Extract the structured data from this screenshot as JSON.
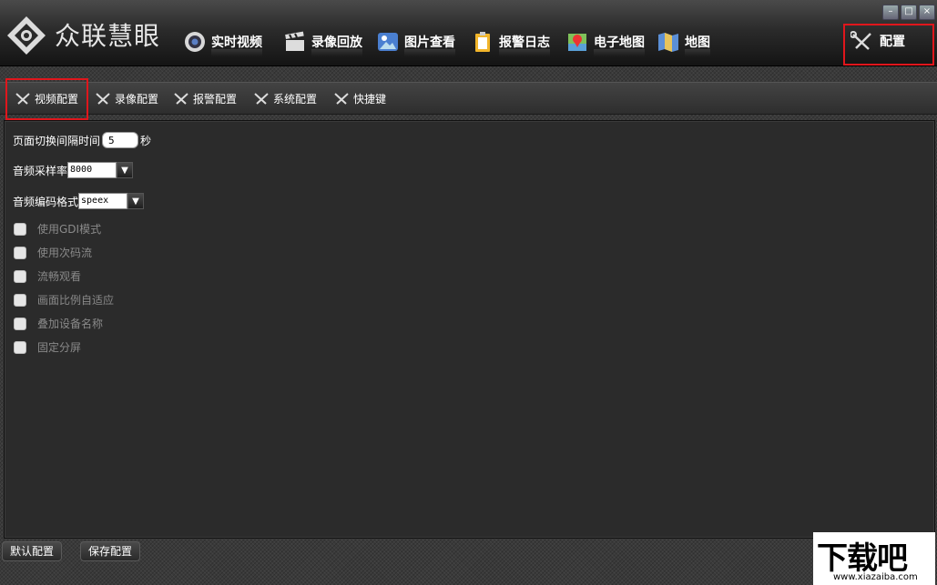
{
  "header": {
    "app_title": "众联慧眼",
    "nav": [
      {
        "label": "实时视频",
        "icon": "camera-lens-icon"
      },
      {
        "label": "录像回放",
        "icon": "clapperboard-icon"
      },
      {
        "label": "图片查看",
        "icon": "picture-icon"
      },
      {
        "label": "报警日志",
        "icon": "clipboard-icon"
      },
      {
        "label": "电子地图",
        "icon": "map-pin-icon"
      },
      {
        "label": "地图",
        "icon": "folded-map-icon"
      }
    ],
    "config_label": "配置",
    "window_controls": [
      "minimize",
      "maximize",
      "close"
    ]
  },
  "tabs": [
    {
      "label": "视频配置",
      "active": true
    },
    {
      "label": "录像配置"
    },
    {
      "label": "报警配置"
    },
    {
      "label": "系统配置"
    },
    {
      "label": "快捷键"
    }
  ],
  "settings": {
    "switch_interval": {
      "label": "页面切换间隔时间",
      "value": "5",
      "unit": "秒"
    },
    "sample_rate": {
      "label": "音频采样率",
      "value": "8000"
    },
    "codec": {
      "label": "音频编码格式",
      "value": "speex"
    },
    "checkboxes": [
      "使用GDI模式",
      "使用次码流",
      "流畅观看",
      "画面比例自适应",
      "叠加设备名称",
      "固定分屏"
    ]
  },
  "footer": {
    "default_button": "默认配置",
    "save_button": "保存配置"
  },
  "watermark": {
    "main": "下载吧",
    "url": "www.xiazaiba.com"
  },
  "colors": {
    "highlight_border": "#e0161c"
  }
}
